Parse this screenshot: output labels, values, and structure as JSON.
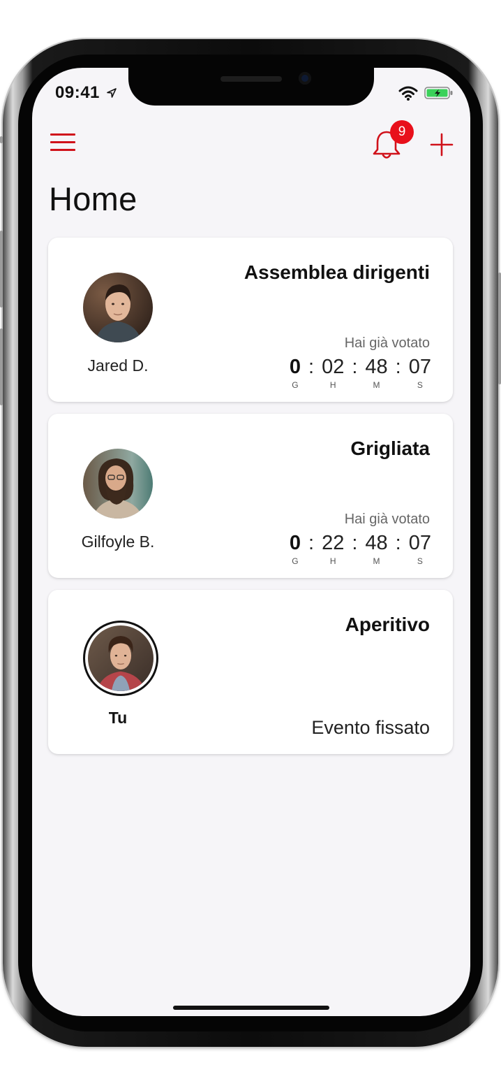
{
  "status_bar": {
    "time": "09:41"
  },
  "header": {
    "menu_icon": "hamburger-menu-icon",
    "notifications_icon": "bell-icon",
    "notifications_count": "9",
    "add_icon": "plus-icon",
    "title": "Home"
  },
  "colors": {
    "accent": "#d0121b",
    "badge": "#e8101b",
    "background": "#f6f5f8",
    "card": "#ffffff"
  },
  "events": [
    {
      "title": "Assemblea dirigenti",
      "person": "Jared D.",
      "status": "Hai già votato",
      "countdown": {
        "days": "0",
        "hours": "02",
        "minutes": "48",
        "seconds": "07"
      },
      "labels": {
        "days": "G",
        "hours": "H",
        "minutes": "M",
        "seconds": "S"
      }
    },
    {
      "title": "Grigliata",
      "person": "Gilfoyle B.",
      "status": "Hai già votato",
      "countdown": {
        "days": "0",
        "hours": "22",
        "minutes": "48",
        "seconds": "07"
      },
      "labels": {
        "days": "G",
        "hours": "H",
        "minutes": "M",
        "seconds": "S"
      }
    },
    {
      "title": "Aperitivo",
      "person": "Tu",
      "status": "Evento fissato"
    }
  ]
}
